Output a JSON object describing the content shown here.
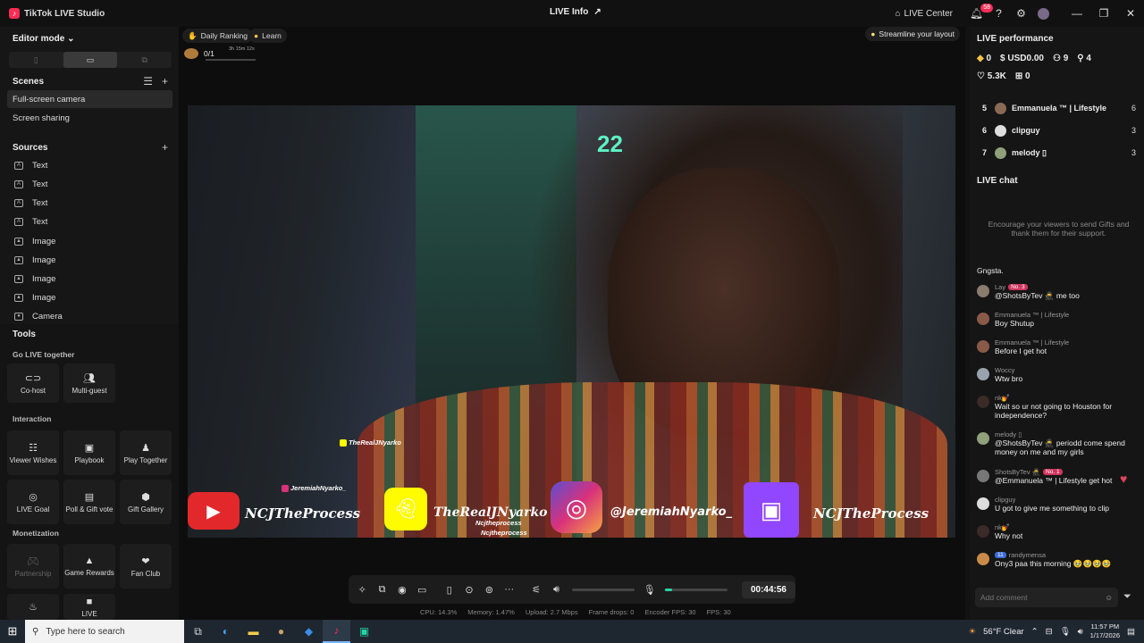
{
  "titlebar": {
    "app_title": "TikTok LIVE Studio",
    "center_title": "LIVE Info",
    "live_center": "LIVE Center",
    "notif_count": "58"
  },
  "left": {
    "editor_mode": "Editor mode",
    "scenes_title": "Scenes",
    "scenes": [
      "Full-screen camera",
      "Screen sharing"
    ],
    "sources_title": "Sources",
    "sources": [
      "Text",
      "Text",
      "Text",
      "Text",
      "Image",
      "Image",
      "Image",
      "Image",
      "Camera"
    ],
    "tools_title": "Tools",
    "go_live_together": "Go LIVE together",
    "interaction": "Interaction",
    "monetization": "Monetization",
    "tools": {
      "cohost": "Co-host",
      "multiguest": "Multi-guest",
      "viewer_wishes": "Viewer Wishes",
      "playbook": "Playbook",
      "play_together": "Play Together",
      "live_goal": "LIVE Goal",
      "poll_gift": "Poll & Gift vote",
      "gift_gallery": "Gift Gallery",
      "partnership": "Partnership",
      "game_rewards": "Game Rewards",
      "fan_club": "Fan Club",
      "live_cut": "LIVE"
    }
  },
  "center": {
    "daily_ranking": "Daily Ranking",
    "learn": "Learn",
    "gift_progress": "0/1",
    "gift_timer": "3h 15m 12s",
    "streamline": "Streamline your layout",
    "overlay": {
      "the_real_handle_small": "TheRealJNyarko",
      "jeremiah_small": "JeremiahNyarko_",
      "yt_text": "NCJTheProcess",
      "snap_text": "TheRealJNyarko",
      "ig_text": "@JeremiahNyarko_",
      "tw_text": "NCJTheProcess",
      "ncj_small_1": "Ncjtheprocess",
      "ncj_small_2": "Ncjtheprocess",
      "neon": "22"
    },
    "timer": "00:44:56",
    "stats": {
      "cpu": "CPU: 14.3%",
      "memory": "Memory: 1.47%",
      "upload": "Upload: 2.7 Mbps",
      "frame_drops": "Frame drops: 0",
      "encoder_fps": "Encoder FPS: 30",
      "fps": "FPS: 30"
    },
    "mic_level": 0.12
  },
  "right": {
    "performance_title": "LIVE performance",
    "perf": {
      "diamonds": "0",
      "usd": "USD0.00",
      "viewers": "9",
      "new_followers": "4",
      "likes": "5.3K",
      "gifts": "0"
    },
    "ranking": [
      {
        "rank": "5",
        "name": "Emmanuela ™ | Lifestyle",
        "count": "6"
      },
      {
        "rank": "6",
        "name": "clipguy",
        "count": "3"
      },
      {
        "rank": "7",
        "name": "melody ▯",
        "count": "3"
      }
    ],
    "chat_title": "LIVE chat",
    "chat_empty": "Encourage your viewers to send Gifts and thank them for their support.",
    "messages": [
      {
        "user": "",
        "tag": "",
        "text": "Gngsta."
      },
      {
        "user": "Lay",
        "tag": "No. 3",
        "text": "@ShotsByTev 🥷 me too"
      },
      {
        "user": "Emmanuela ™ | Lifestyle",
        "tag": "",
        "text": "Boy Shutup"
      },
      {
        "user": "Emmanuela ™ | Lifestyle",
        "tag": "",
        "text": "Before I get hot"
      },
      {
        "user": "Woccy",
        "tag": "",
        "text": "Wtw bro"
      },
      {
        "user": "nk💅",
        "tag": "",
        "text": "Wait so ur not going to Houston for independence?"
      },
      {
        "user": "melody ▯",
        "tag": "",
        "text": "@ShotsByTev 🥷 periodd come spend money on me and my girls"
      },
      {
        "user": "ShotsByTev 🥷",
        "tag": "No. 1",
        "text": "@Emmanuela ™ | Lifestyle get hot"
      },
      {
        "user": "clipguy",
        "tag": "",
        "text": "U got to give me something to clip"
      },
      {
        "user": "nk💅",
        "tag": "",
        "text": "Why not"
      },
      {
        "user": "randymensa",
        "tag": "11",
        "text": "Ony3 paa this morning 🥹🥹🥹🥹"
      }
    ],
    "comment_placeholder": "Add comment"
  },
  "taskbar": {
    "search_placeholder": "Type here to search",
    "weather": "56°F  Clear",
    "time": "11:57 PM",
    "date": "1/17/2026"
  },
  "colors": {
    "accent": "#fe2c55",
    "mic_level": "#25d4a4",
    "twitch": "#9146ff",
    "youtube": "#e3282b",
    "snapchat": "#fffc00"
  }
}
